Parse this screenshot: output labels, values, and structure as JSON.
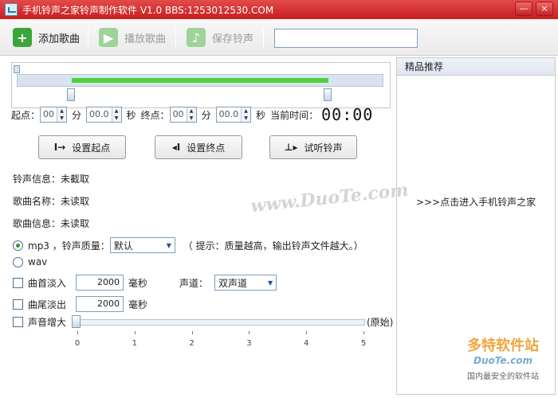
{
  "window": {
    "title": "手机铃声之家铃声制作软件   V1.0   BBS:1253012530.COM",
    "minimize_label": "—",
    "close_label": "×"
  },
  "toolbar": {
    "add_song": "添加歌曲",
    "play_song": "播放歌曲",
    "save_ringtone": "保存铃声",
    "search_value": ""
  },
  "time": {
    "start_label": "起点：",
    "start_min": "00",
    "min_unit": "分",
    "start_sec": "00.0",
    "sec_unit": "秒",
    "end_label": "终点：",
    "end_min": "00",
    "end_sec": "00.0",
    "current_label": "当前时间：",
    "current_value": "00:00"
  },
  "actions": {
    "set_start": "设置起点",
    "set_end": "设置终点",
    "preview": "试听铃声"
  },
  "info": {
    "ringtone_info": "铃声信息：未截取",
    "song_name": "歌曲名称：未读取",
    "song_info": "歌曲信息：未读取"
  },
  "format": {
    "mp3_label": "mp3 ，铃声质量：",
    "quality_value": "默认",
    "hint": "（ 提示：质量越高，输出铃声文件越大。）",
    "wav_label": "wav",
    "selected": "mp3"
  },
  "effects": {
    "fade_in_label": "曲首淡入",
    "fade_in_value": "2000",
    "fade_out_label": "曲尾淡出",
    "fade_out_value": "2000",
    "ms_unit": "毫秒",
    "channel_label": "声道：",
    "channel_value": "双声道",
    "volume_label": "声音增大",
    "volume_hint": "(原始)",
    "volume_ticks": [
      "0",
      "1",
      "2",
      "3",
      "4",
      "5"
    ],
    "volume_value": 0
  },
  "right_panel": {
    "header": "精品推荐",
    "link": ">>>点击进入手机铃声之家"
  },
  "watermark": {
    "center": "www.DuoTe.com",
    "logo_big": "多特软件站",
    "logo_mid": "DuoTe.com",
    "logo_small": "国内最安全的软件站"
  },
  "colors": {
    "titlebar": "#d02828",
    "selection": "#4cd13c",
    "add_icon": "#3aa53a"
  }
}
